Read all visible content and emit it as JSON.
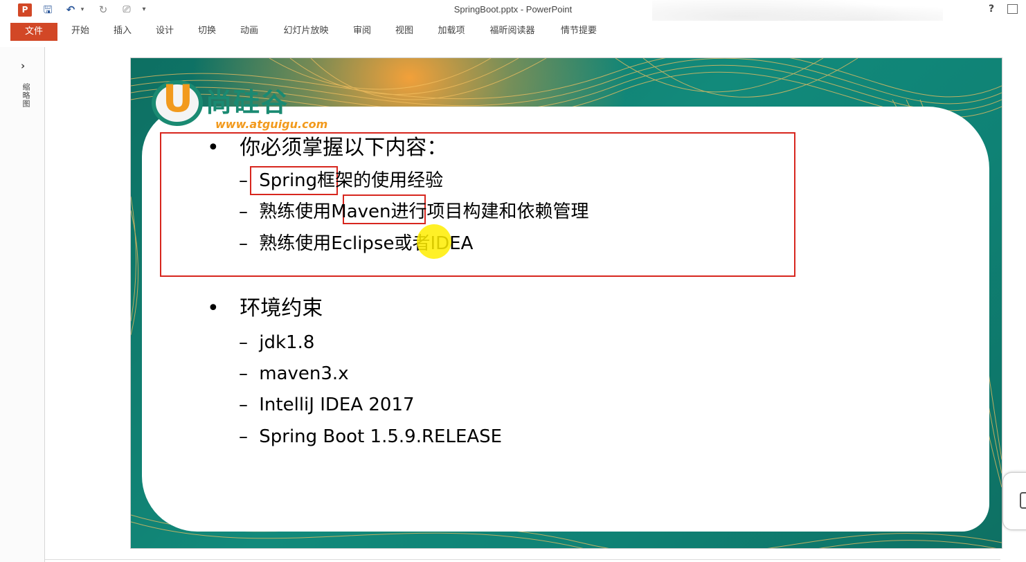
{
  "window": {
    "title": "SpringBoot.pptx - PowerPoint",
    "app_icon": "P",
    "help": "?",
    "restore": "▭"
  },
  "quick_access": {
    "save": "💾",
    "undo": "↶",
    "undo_dropdown": "▾",
    "redo": "↻",
    "present": "⎚",
    "customize": "▾"
  },
  "ribbon": {
    "tabs": [
      "文件",
      "开始",
      "插入",
      "设计",
      "切换",
      "动画",
      "幻灯片放映",
      "审阅",
      "视图",
      "加载项",
      "福昕阅读器",
      "情节提要"
    ]
  },
  "thumbnail_pane": {
    "expand": "›",
    "label": "缩略图"
  },
  "slide": {
    "logo": {
      "badge": "U",
      "name": "尚硅谷",
      "url": "www.atguigu.com"
    },
    "sections": [
      {
        "heading": "你必须掌握以下内容：",
        "items": [
          "Spring框架的使用经验",
          "熟练使用Maven进行项目构建和依赖管理",
          "熟练使用Eclipse或者IDEA"
        ]
      },
      {
        "heading": "环境约束",
        "items": [
          "jdk1.8",
          "maven3.x",
          "IntelliJ IDEA 2017",
          "Spring Boot 1.5.9.RELEASE"
        ]
      }
    ],
    "bullet": "•",
    "dash": "–",
    "colors": {
      "teal": "#128a7b",
      "orange": "#f29a1d",
      "annotation_red": "#d7261e",
      "pointer_yellow": "#ffed00"
    }
  }
}
